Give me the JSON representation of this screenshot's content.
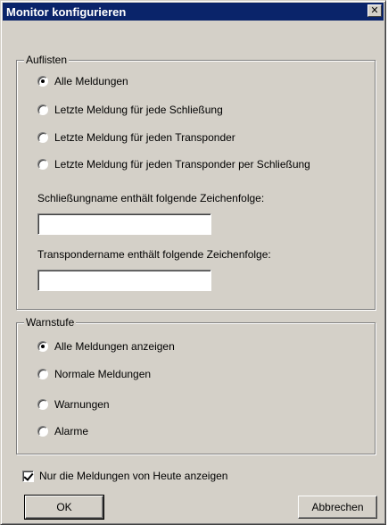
{
  "window": {
    "title": "Monitor konfigurieren",
    "close_glyph": "✕"
  },
  "auflisten": {
    "label": "Auflisten",
    "options": [
      {
        "label": "Alle Meldungen",
        "checked": true
      },
      {
        "label": "Letzte Meldung für jede Schließung",
        "checked": false
      },
      {
        "label": "Letzte Meldung für jeden Transponder",
        "checked": false
      },
      {
        "label": "Letzte Meldung für jeden Transponder per Schließung",
        "checked": false
      }
    ],
    "schliessung_label": "Schließungname enthält folgende Zeichenfolge:",
    "schliessung_value": "",
    "transponder_label": "Transpondername enthält folgende Zeichenfolge:",
    "transponder_value": ""
  },
  "warnstufe": {
    "label": "Warnstufe",
    "options": [
      {
        "label": "Alle Meldungen anzeigen",
        "checked": true
      },
      {
        "label": "Normale Meldungen",
        "checked": false
      },
      {
        "label": "Warnungen",
        "checked": false
      },
      {
        "label": "Alarme",
        "checked": false
      }
    ]
  },
  "today_only": {
    "label": "Nur die Meldungen von Heute anzeigen",
    "checked": true
  },
  "buttons": {
    "ok": "OK",
    "cancel": "Abbrechen"
  },
  "colors": {
    "titlebar": "#0a246a",
    "face": "#d4d0c8"
  }
}
